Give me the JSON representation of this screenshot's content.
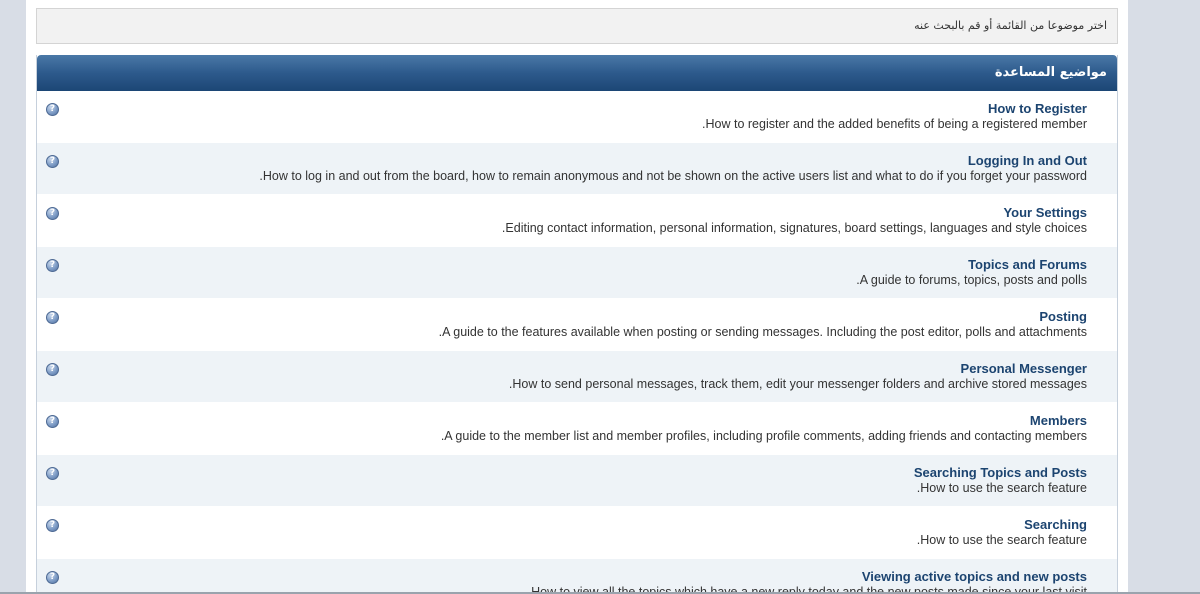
{
  "intro": {
    "text": "اختر موضوعا من القائمة أو قم بالبحث عنه"
  },
  "panel": {
    "title": "مواضيع المساعدة"
  },
  "icons": {
    "help": "question-icon",
    "glyph": "?"
  },
  "colors": {
    "header_top": "#4a78a7",
    "header_bottom": "#1c4675",
    "title_link": "#1c4470",
    "row_alt": "#eef3f7"
  },
  "topics": [
    {
      "title": "How to Register",
      "description": "How to register and the added benefits of being a registered member."
    },
    {
      "title": "Logging In and Out",
      "description": "How to log in and out from the board, how to remain anonymous and not be shown on the active users list and what to do if you forget your password."
    },
    {
      "title": "Your Settings",
      "description": "Editing contact information, personal information, signatures, board settings, languages and style choices."
    },
    {
      "title": "Topics and Forums",
      "description": "A guide to forums, topics, posts and polls."
    },
    {
      "title": "Posting",
      "description": "A guide to the features available when posting or sending messages. Including the post editor, polls and attachments."
    },
    {
      "title": "Personal Messenger",
      "description": "How to send personal messages, track them, edit your messenger folders and archive stored messages."
    },
    {
      "title": "Members",
      "description": "A guide to the member list and member profiles, including profile comments, adding friends and contacting members."
    },
    {
      "title": "Searching Topics and Posts",
      "description": "How to use the search feature."
    },
    {
      "title": "Searching",
      "description": "How to use the search feature."
    },
    {
      "title": "Viewing active topics and new posts",
      "description": "How to view all the topics which have a new reply today and the new posts made since your last visit."
    }
  ]
}
